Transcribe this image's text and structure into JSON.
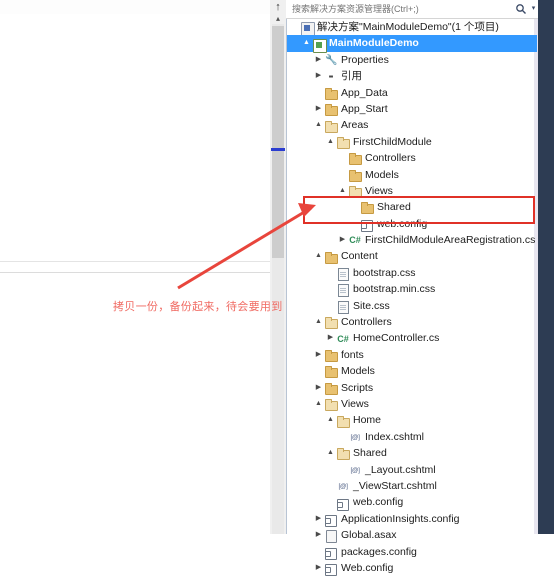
{
  "window": {
    "title": "Solution Explorer",
    "accent_color": "#3399ff",
    "highlight_color": "#e03127",
    "annotation_color": "#f06a62"
  },
  "search": {
    "placeholder": "搜索解决方案资源管理器(Ctrl+;)",
    "value": "",
    "icon": "search-icon",
    "caret": "▾"
  },
  "annotation": {
    "text": "拷贝一份，备份起来，待会要用到"
  },
  "gutter": {
    "icon_top": "↑",
    "icon_bottom": "▴"
  },
  "tree": {
    "nodes": [
      {
        "label": "解决方案\"MainModuleDemo\"(1 个项目)",
        "indent": 0,
        "icon": "solution-icon",
        "expander": "",
        "selected": false
      },
      {
        "label": "MainModuleDemo",
        "indent": 1,
        "icon": "project-icon",
        "expander": "▲",
        "selected": true
      },
      {
        "label": "Properties",
        "indent": 2,
        "icon": "wrench-icon",
        "expander": "▶",
        "selected": false
      },
      {
        "label": "引用",
        "indent": 2,
        "icon": "references-icon",
        "expander": "▶",
        "selected": false
      },
      {
        "label": "App_Data",
        "indent": 2,
        "icon": "folder-icon",
        "expander": "",
        "selected": false
      },
      {
        "label": "App_Start",
        "indent": 2,
        "icon": "folder-icon",
        "expander": "▶",
        "selected": false
      },
      {
        "label": "Areas",
        "indent": 2,
        "icon": "folder-open-icon",
        "expander": "▲",
        "selected": false
      },
      {
        "label": "FirstChildModule",
        "indent": 3,
        "icon": "folder-open-icon",
        "expander": "▲",
        "selected": false
      },
      {
        "label": "Controllers",
        "indent": 4,
        "icon": "folder-icon",
        "expander": "",
        "selected": false
      },
      {
        "label": "Models",
        "indent": 4,
        "icon": "folder-icon",
        "expander": "",
        "selected": false
      },
      {
        "label": "Views",
        "indent": 4,
        "icon": "folder-open-icon",
        "expander": "▲",
        "selected": false
      },
      {
        "label": "Shared",
        "indent": 5,
        "icon": "folder-icon",
        "expander": "",
        "selected": false
      },
      {
        "label": "web.config",
        "indent": 5,
        "icon": "config-icon",
        "expander": "",
        "selected": false
      },
      {
        "label": "FirstChildModuleAreaRegistration.cs",
        "indent": 4,
        "icon": "csharp-icon",
        "expander": "▶",
        "selected": false
      },
      {
        "label": "Content",
        "indent": 2,
        "icon": "folder-icon",
        "expander": "▲",
        "selected": false
      },
      {
        "label": "bootstrap.css",
        "indent": 3,
        "icon": "css-icon",
        "expander": "",
        "selected": false
      },
      {
        "label": "bootstrap.min.css",
        "indent": 3,
        "icon": "css-icon",
        "expander": "",
        "selected": false
      },
      {
        "label": "Site.css",
        "indent": 3,
        "icon": "css-icon",
        "expander": "",
        "selected": false
      },
      {
        "label": "Controllers",
        "indent": 2,
        "icon": "folder-open-icon",
        "expander": "▲",
        "selected": false
      },
      {
        "label": "HomeController.cs",
        "indent": 3,
        "icon": "csharp-icon",
        "expander": "▶",
        "selected": false
      },
      {
        "label": "fonts",
        "indent": 2,
        "icon": "folder-icon",
        "expander": "▶",
        "selected": false
      },
      {
        "label": "Models",
        "indent": 2,
        "icon": "folder-icon",
        "expander": "",
        "selected": false
      },
      {
        "label": "Scripts",
        "indent": 2,
        "icon": "folder-icon",
        "expander": "▶",
        "selected": false
      },
      {
        "label": "Views",
        "indent": 2,
        "icon": "folder-open-icon",
        "expander": "▲",
        "selected": false
      },
      {
        "label": "Home",
        "indent": 3,
        "icon": "folder-open-icon",
        "expander": "▲",
        "selected": false
      },
      {
        "label": "Index.cshtml",
        "indent": 4,
        "icon": "razor-icon",
        "expander": "",
        "selected": false
      },
      {
        "label": "Shared",
        "indent": 3,
        "icon": "folder-open-icon",
        "expander": "▲",
        "selected": false
      },
      {
        "label": "_Layout.cshtml",
        "indent": 4,
        "icon": "razor-icon",
        "expander": "",
        "selected": false
      },
      {
        "label": "_ViewStart.cshtml",
        "indent": 3,
        "icon": "razor-icon",
        "expander": "",
        "selected": false
      },
      {
        "label": "web.config",
        "indent": 3,
        "icon": "config-icon",
        "expander": "",
        "selected": false
      },
      {
        "label": "ApplicationInsights.config",
        "indent": 2,
        "icon": "config-icon",
        "expander": "▶",
        "selected": false
      },
      {
        "label": "Global.asax",
        "indent": 2,
        "icon": "asax-icon",
        "expander": "▶",
        "selected": false
      },
      {
        "label": "packages.config",
        "indent": 2,
        "icon": "config-icon",
        "expander": "",
        "selected": false
      },
      {
        "label": "Web.config",
        "indent": 2,
        "icon": "config-icon",
        "expander": "▶",
        "selected": false
      }
    ]
  }
}
